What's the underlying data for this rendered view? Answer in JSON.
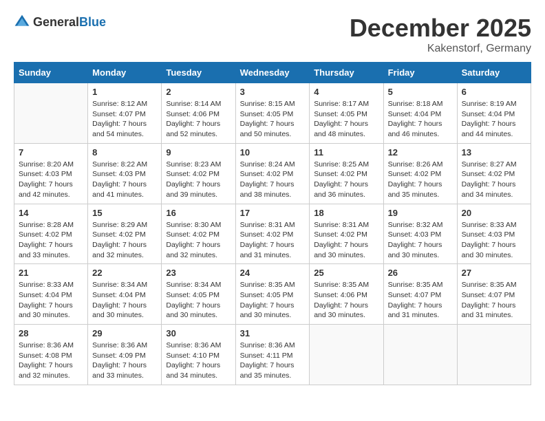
{
  "header": {
    "logo_general": "General",
    "logo_blue": "Blue",
    "month": "December 2025",
    "location": "Kakenstorf, Germany"
  },
  "weekdays": [
    "Sunday",
    "Monday",
    "Tuesday",
    "Wednesday",
    "Thursday",
    "Friday",
    "Saturday"
  ],
  "weeks": [
    [
      {
        "day": "",
        "info": ""
      },
      {
        "day": "1",
        "info": "Sunrise: 8:12 AM\nSunset: 4:07 PM\nDaylight: 7 hours\nand 54 minutes."
      },
      {
        "day": "2",
        "info": "Sunrise: 8:14 AM\nSunset: 4:06 PM\nDaylight: 7 hours\nand 52 minutes."
      },
      {
        "day": "3",
        "info": "Sunrise: 8:15 AM\nSunset: 4:05 PM\nDaylight: 7 hours\nand 50 minutes."
      },
      {
        "day": "4",
        "info": "Sunrise: 8:17 AM\nSunset: 4:05 PM\nDaylight: 7 hours\nand 48 minutes."
      },
      {
        "day": "5",
        "info": "Sunrise: 8:18 AM\nSunset: 4:04 PM\nDaylight: 7 hours\nand 46 minutes."
      },
      {
        "day": "6",
        "info": "Sunrise: 8:19 AM\nSunset: 4:04 PM\nDaylight: 7 hours\nand 44 minutes."
      }
    ],
    [
      {
        "day": "7",
        "info": "Sunrise: 8:20 AM\nSunset: 4:03 PM\nDaylight: 7 hours\nand 42 minutes."
      },
      {
        "day": "8",
        "info": "Sunrise: 8:22 AM\nSunset: 4:03 PM\nDaylight: 7 hours\nand 41 minutes."
      },
      {
        "day": "9",
        "info": "Sunrise: 8:23 AM\nSunset: 4:02 PM\nDaylight: 7 hours\nand 39 minutes."
      },
      {
        "day": "10",
        "info": "Sunrise: 8:24 AM\nSunset: 4:02 PM\nDaylight: 7 hours\nand 38 minutes."
      },
      {
        "day": "11",
        "info": "Sunrise: 8:25 AM\nSunset: 4:02 PM\nDaylight: 7 hours\nand 36 minutes."
      },
      {
        "day": "12",
        "info": "Sunrise: 8:26 AM\nSunset: 4:02 PM\nDaylight: 7 hours\nand 35 minutes."
      },
      {
        "day": "13",
        "info": "Sunrise: 8:27 AM\nSunset: 4:02 PM\nDaylight: 7 hours\nand 34 minutes."
      }
    ],
    [
      {
        "day": "14",
        "info": "Sunrise: 8:28 AM\nSunset: 4:02 PM\nDaylight: 7 hours\nand 33 minutes."
      },
      {
        "day": "15",
        "info": "Sunrise: 8:29 AM\nSunset: 4:02 PM\nDaylight: 7 hours\nand 32 minutes."
      },
      {
        "day": "16",
        "info": "Sunrise: 8:30 AM\nSunset: 4:02 PM\nDaylight: 7 hours\nand 32 minutes."
      },
      {
        "day": "17",
        "info": "Sunrise: 8:31 AM\nSunset: 4:02 PM\nDaylight: 7 hours\nand 31 minutes."
      },
      {
        "day": "18",
        "info": "Sunrise: 8:31 AM\nSunset: 4:02 PM\nDaylight: 7 hours\nand 30 minutes."
      },
      {
        "day": "19",
        "info": "Sunrise: 8:32 AM\nSunset: 4:03 PM\nDaylight: 7 hours\nand 30 minutes."
      },
      {
        "day": "20",
        "info": "Sunrise: 8:33 AM\nSunset: 4:03 PM\nDaylight: 7 hours\nand 30 minutes."
      }
    ],
    [
      {
        "day": "21",
        "info": "Sunrise: 8:33 AM\nSunset: 4:04 PM\nDaylight: 7 hours\nand 30 minutes."
      },
      {
        "day": "22",
        "info": "Sunrise: 8:34 AM\nSunset: 4:04 PM\nDaylight: 7 hours\nand 30 minutes."
      },
      {
        "day": "23",
        "info": "Sunrise: 8:34 AM\nSunset: 4:05 PM\nDaylight: 7 hours\nand 30 minutes."
      },
      {
        "day": "24",
        "info": "Sunrise: 8:35 AM\nSunset: 4:05 PM\nDaylight: 7 hours\nand 30 minutes."
      },
      {
        "day": "25",
        "info": "Sunrise: 8:35 AM\nSunset: 4:06 PM\nDaylight: 7 hours\nand 30 minutes."
      },
      {
        "day": "26",
        "info": "Sunrise: 8:35 AM\nSunset: 4:07 PM\nDaylight: 7 hours\nand 31 minutes."
      },
      {
        "day": "27",
        "info": "Sunrise: 8:35 AM\nSunset: 4:07 PM\nDaylight: 7 hours\nand 31 minutes."
      }
    ],
    [
      {
        "day": "28",
        "info": "Sunrise: 8:36 AM\nSunset: 4:08 PM\nDaylight: 7 hours\nand 32 minutes."
      },
      {
        "day": "29",
        "info": "Sunrise: 8:36 AM\nSunset: 4:09 PM\nDaylight: 7 hours\nand 33 minutes."
      },
      {
        "day": "30",
        "info": "Sunrise: 8:36 AM\nSunset: 4:10 PM\nDaylight: 7 hours\nand 34 minutes."
      },
      {
        "day": "31",
        "info": "Sunrise: 8:36 AM\nSunset: 4:11 PM\nDaylight: 7 hours\nand 35 minutes."
      },
      {
        "day": "",
        "info": ""
      },
      {
        "day": "",
        "info": ""
      },
      {
        "day": "",
        "info": ""
      }
    ]
  ]
}
